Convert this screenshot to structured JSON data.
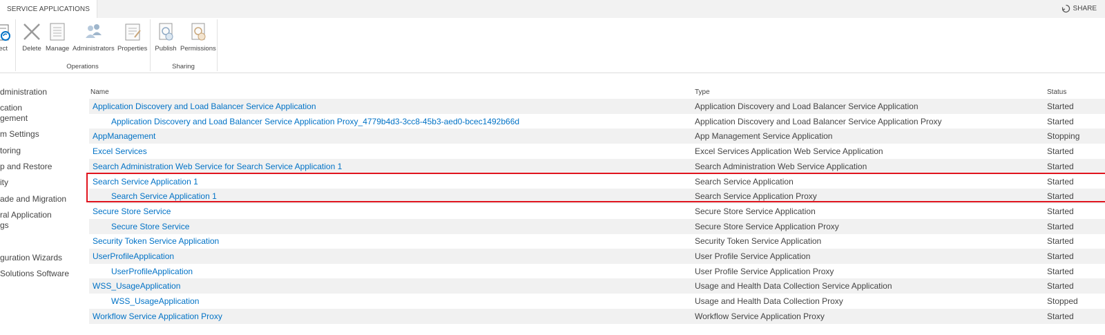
{
  "tab": {
    "label": "SERVICE APPLICATIONS"
  },
  "share": {
    "label": "SHARE"
  },
  "ribbon": {
    "connect_label": "nect",
    "buttons": [
      {
        "label": "Delete",
        "icon": "delete-icon"
      },
      {
        "label": "Manage",
        "icon": "manage-icon"
      },
      {
        "label": "Administrators",
        "icon": "administrators-icon"
      },
      {
        "label": "Properties",
        "icon": "properties-icon"
      },
      {
        "label": "Publish",
        "icon": "publish-icon"
      },
      {
        "label": "Permissions",
        "icon": "permissions-icon"
      }
    ],
    "groups": [
      {
        "label": "Operations"
      },
      {
        "label": "Sharing"
      }
    ]
  },
  "leftnav": {
    "items": [
      "dministration",
      "cation",
      "gement",
      "m Settings",
      "toring",
      "p and Restore",
      "ity",
      "ade and Migration",
      "ral Application",
      "gs",
      "guration Wizards",
      "Solutions Software"
    ]
  },
  "table": {
    "headers": {
      "name": "Name",
      "type": "Type",
      "status": "Status"
    },
    "rows": [
      {
        "name": "Application Discovery and Load Balancer Service Application",
        "type": "Application Discovery and Load Balancer Service Application",
        "status": "Started",
        "sub": false
      },
      {
        "name": "Application Discovery and Load Balancer Service Application Proxy_4779b4d3-3cc8-45b3-aed0-bcec1492b66d",
        "type": "Application Discovery and Load Balancer Service Application Proxy",
        "status": "Started",
        "sub": true
      },
      {
        "name": "AppManagement",
        "type": "App Management Service Application",
        "status": "Stopping",
        "sub": false
      },
      {
        "name": "Excel Services",
        "type": "Excel Services Application Web Service Application",
        "status": "Started",
        "sub": false
      },
      {
        "name": "Search Administration Web Service for Search Service Application 1",
        "type": "Search Administration Web Service Application",
        "status": "Started",
        "sub": false
      },
      {
        "name": "Search Service Application 1",
        "type": "Search Service Application",
        "status": "Started",
        "sub": false
      },
      {
        "name": "Search Service Application 1",
        "type": "Search Service Application Proxy",
        "status": "Started",
        "sub": true
      },
      {
        "name": "Secure Store Service",
        "type": "Secure Store Service Application",
        "status": "Started",
        "sub": false
      },
      {
        "name": "Secure Store Service",
        "type": "Secure Store Service Application Proxy",
        "status": "Started",
        "sub": true
      },
      {
        "name": "Security Token Service Application",
        "type": "Security Token Service Application",
        "status": "Started",
        "sub": false
      },
      {
        "name": "UserProfileApplication",
        "type": "User Profile Service Application",
        "status": "Started",
        "sub": false
      },
      {
        "name": "UserProfileApplication",
        "type": "User Profile Service Application Proxy",
        "status": "Started",
        "sub": true
      },
      {
        "name": "WSS_UsageApplication",
        "type": "Usage and Health Data Collection Service Application",
        "status": "Started",
        "sub": false
      },
      {
        "name": "WSS_UsageApplication",
        "type": "Usage and Health Data Collection Proxy",
        "status": "Stopped",
        "sub": true
      },
      {
        "name": "Workflow Service Application Proxy",
        "type": "Workflow Service Application Proxy",
        "status": "Started",
        "sub": false
      }
    ]
  },
  "colors": {
    "link": "#0072c6",
    "highlight": "#e0141e",
    "alt_row": "#f1f1f1"
  }
}
